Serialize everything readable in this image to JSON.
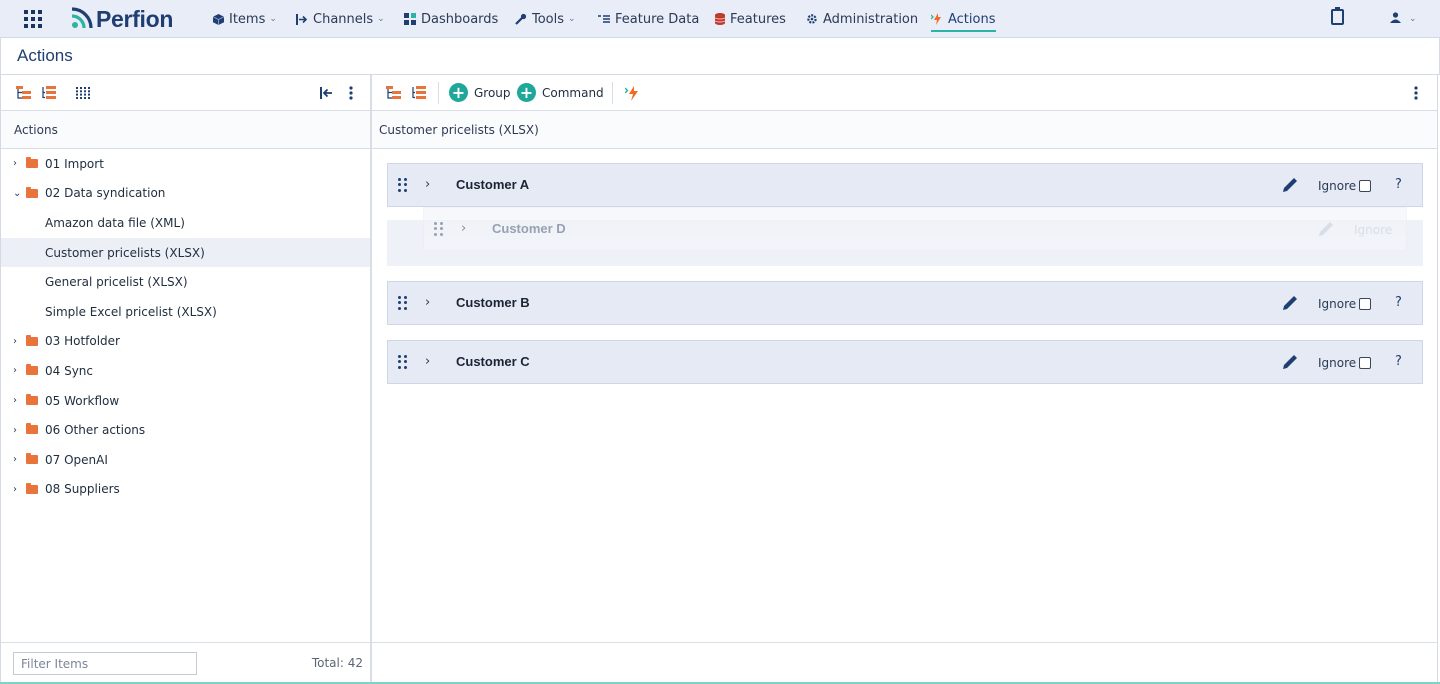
{
  "app": {
    "logo_text": "Perfion"
  },
  "nav": {
    "items": [
      {
        "label": "Items",
        "icon": "cube-icon",
        "has_menu": true
      },
      {
        "label": "Channels",
        "icon": "channel-arrow-icon",
        "has_menu": true
      },
      {
        "label": "Dashboards",
        "icon": "grid-icon",
        "has_menu": false
      },
      {
        "label": "Tools",
        "icon": "wrench-icon",
        "has_menu": true
      },
      {
        "label": "Feature Data",
        "icon": "list-icon",
        "has_menu": false
      },
      {
        "label": "Features",
        "icon": "database-icon",
        "has_menu": false
      },
      {
        "label": "Administration",
        "icon": "gear-icon",
        "has_menu": false
      },
      {
        "label": "Actions",
        "icon": "lightning-icon",
        "has_menu": false,
        "active": true
      }
    ]
  },
  "page": {
    "title": "Actions"
  },
  "left_panel": {
    "header": "Actions",
    "tree": [
      {
        "label": "01 Import",
        "type": "folder",
        "expanded": false
      },
      {
        "label": "02 Data syndication",
        "type": "folder",
        "expanded": true
      },
      {
        "label": "Amazon data file (XML)",
        "type": "action"
      },
      {
        "label": "Customer pricelists (XLSX)",
        "type": "action",
        "selected": true
      },
      {
        "label": "General pricelist (XLSX)",
        "type": "action"
      },
      {
        "label": "Simple Excel pricelist (XLSX)",
        "type": "action"
      },
      {
        "label": "03 Hotfolder",
        "type": "folder",
        "expanded": false
      },
      {
        "label": "04 Sync",
        "type": "folder",
        "expanded": false
      },
      {
        "label": "05 Workflow",
        "type": "folder",
        "expanded": false
      },
      {
        "label": "06 Other actions",
        "type": "folder",
        "expanded": false
      },
      {
        "label": "07 OpenAI",
        "type": "folder",
        "expanded": false
      },
      {
        "label": "08 Suppliers",
        "type": "folder",
        "expanded": false
      }
    ],
    "filter_placeholder": "Filter Items",
    "total_label": "Total: 42"
  },
  "right_panel": {
    "toolbar": {
      "group_label": "Group",
      "command_label": "Command"
    },
    "header": "Customer pricelists (XLSX)",
    "groups": [
      {
        "name": "Customer A",
        "ignore_label": "Ignore",
        "ignored": false,
        "help": "?"
      },
      {
        "name": "Customer B",
        "ignore_label": "Ignore",
        "ignored": false,
        "help": "?"
      },
      {
        "name": "Customer C",
        "ignore_label": "Ignore",
        "ignored": false,
        "help": "?"
      }
    ],
    "dragging": {
      "name": "Customer D",
      "ignore_label": "Ignore"
    }
  },
  "colors": {
    "accent": "#2bb3a3",
    "brand": "#1f3e72",
    "folder": "#e8743b",
    "add": "#1fa89a",
    "lightning": "#f26a21"
  }
}
